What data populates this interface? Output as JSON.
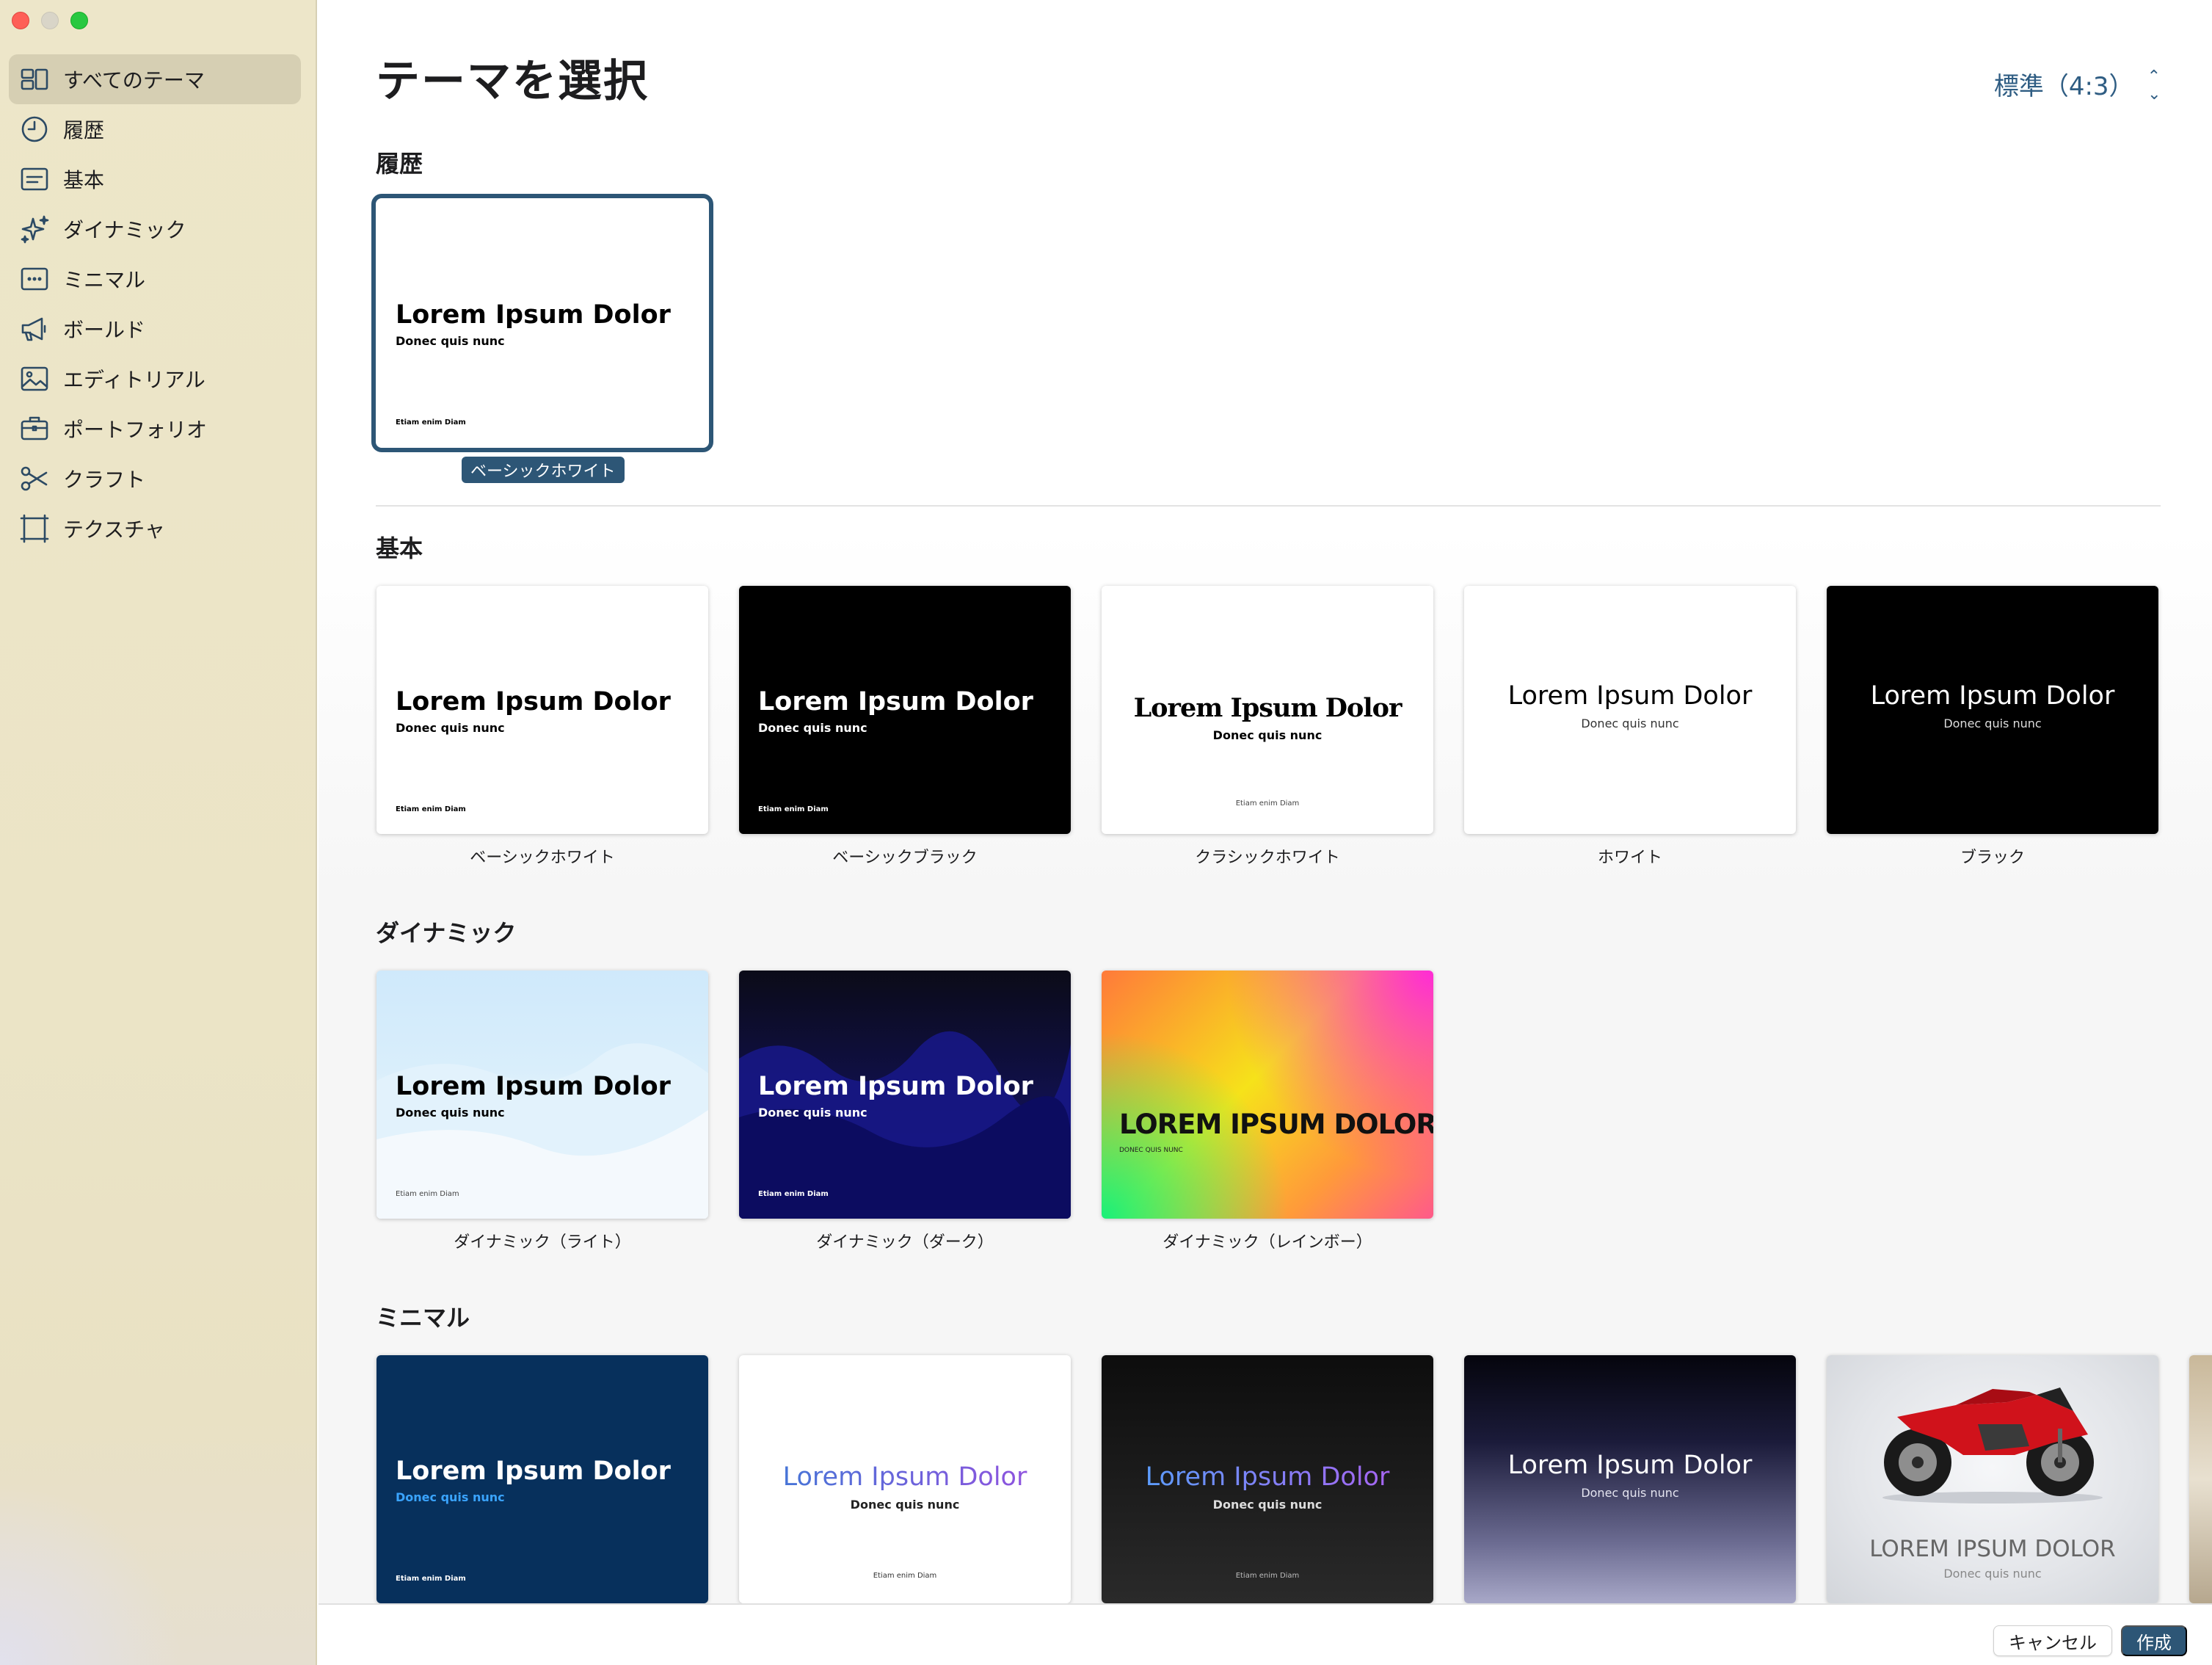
{
  "window": {
    "title": "テーマを選択"
  },
  "sidebar": {
    "items": [
      {
        "label": "すべてのテーマ",
        "icon": "all-themes-icon",
        "active": true
      },
      {
        "label": "履歴",
        "icon": "clock-icon"
      },
      {
        "label": "基本",
        "icon": "text-lines-icon"
      },
      {
        "label": "ダイナミック",
        "icon": "sparkles-icon"
      },
      {
        "label": "ミニマル",
        "icon": "ellipsis-rect-icon"
      },
      {
        "label": "ボールド",
        "icon": "megaphone-icon"
      },
      {
        "label": "エディトリアル",
        "icon": "photo-icon"
      },
      {
        "label": "ポートフォリオ",
        "icon": "briefcase-icon"
      },
      {
        "label": "クラフト",
        "icon": "scissors-icon"
      },
      {
        "label": "テクスチャ",
        "icon": "texture-frame-icon"
      }
    ]
  },
  "header": {
    "aspect_ratio": "標準（4:3）"
  },
  "sections": {
    "recent": {
      "title": "履歴",
      "themes": [
        {
          "name": "ベーシックホワイト",
          "t1": "Lorem Ipsum Dolor",
          "t2": "Donec quis nunc",
          "t3": "Etiam enim Diam"
        }
      ]
    },
    "basic": {
      "title": "基本",
      "themes": [
        {
          "name": "ベーシックホワイト",
          "t1": "Lorem Ipsum Dolor",
          "t2": "Donec quis nunc",
          "t3": "Etiam enim Diam"
        },
        {
          "name": "ベーシックブラック",
          "t1": "Lorem Ipsum Dolor",
          "t2": "Donec quis nunc",
          "t3": "Etiam enim Diam"
        },
        {
          "name": "クラシックホワイト",
          "t1": "Lorem Ipsum Dolor",
          "t2": "Donec quis nunc",
          "t3": "Etiam enim Diam"
        },
        {
          "name": "ホワイト",
          "t1": "Lorem Ipsum Dolor",
          "t2": "Donec quis nunc"
        },
        {
          "name": "ブラック",
          "t1": "Lorem Ipsum Dolor",
          "t2": "Donec quis nunc"
        }
      ]
    },
    "dynamic": {
      "title": "ダイナミック",
      "themes": [
        {
          "name": "ダイナミック（ライト）",
          "t1": "Lorem Ipsum Dolor",
          "t2": "Donec quis nunc",
          "t3": "Etiam enim Diam"
        },
        {
          "name": "ダイナミック（ダーク）",
          "t1": "Lorem Ipsum Dolor",
          "t2": "Donec quis nunc",
          "t3": "Etiam enim Diam"
        },
        {
          "name": "ダイナミック（レインボー）",
          "t1": "LOREM IPSUM DOLOR",
          "t2": "DONEC QUIS NUNC"
        }
      ]
    },
    "minimal": {
      "title": "ミニマル",
      "themes": [
        {
          "t1": "Lorem Ipsum Dolor",
          "t2": "Donec quis nunc",
          "t3": "Etiam enim Diam"
        },
        {
          "t1": "Lorem Ipsum Dolor",
          "t2": "Donec quis nunc",
          "t3": "Etiam enim Diam"
        },
        {
          "t1": "Lorem Ipsum Dolor",
          "t2": "Donec quis nunc",
          "t3": "Etiam enim Diam"
        },
        {
          "t1": "Lorem Ipsum Dolor",
          "t2": "Donec quis nunc"
        },
        {
          "t1": "LOREM IPSUM DOLOR",
          "t2": "Donec quis nunc"
        }
      ]
    }
  },
  "footer": {
    "cancel_label": "キャンセル",
    "create_label": "作成"
  },
  "colors": {
    "accent": "#2d5676",
    "sidebar_bg": "#ebe4c6",
    "section_band": "#f5f5f5"
  }
}
